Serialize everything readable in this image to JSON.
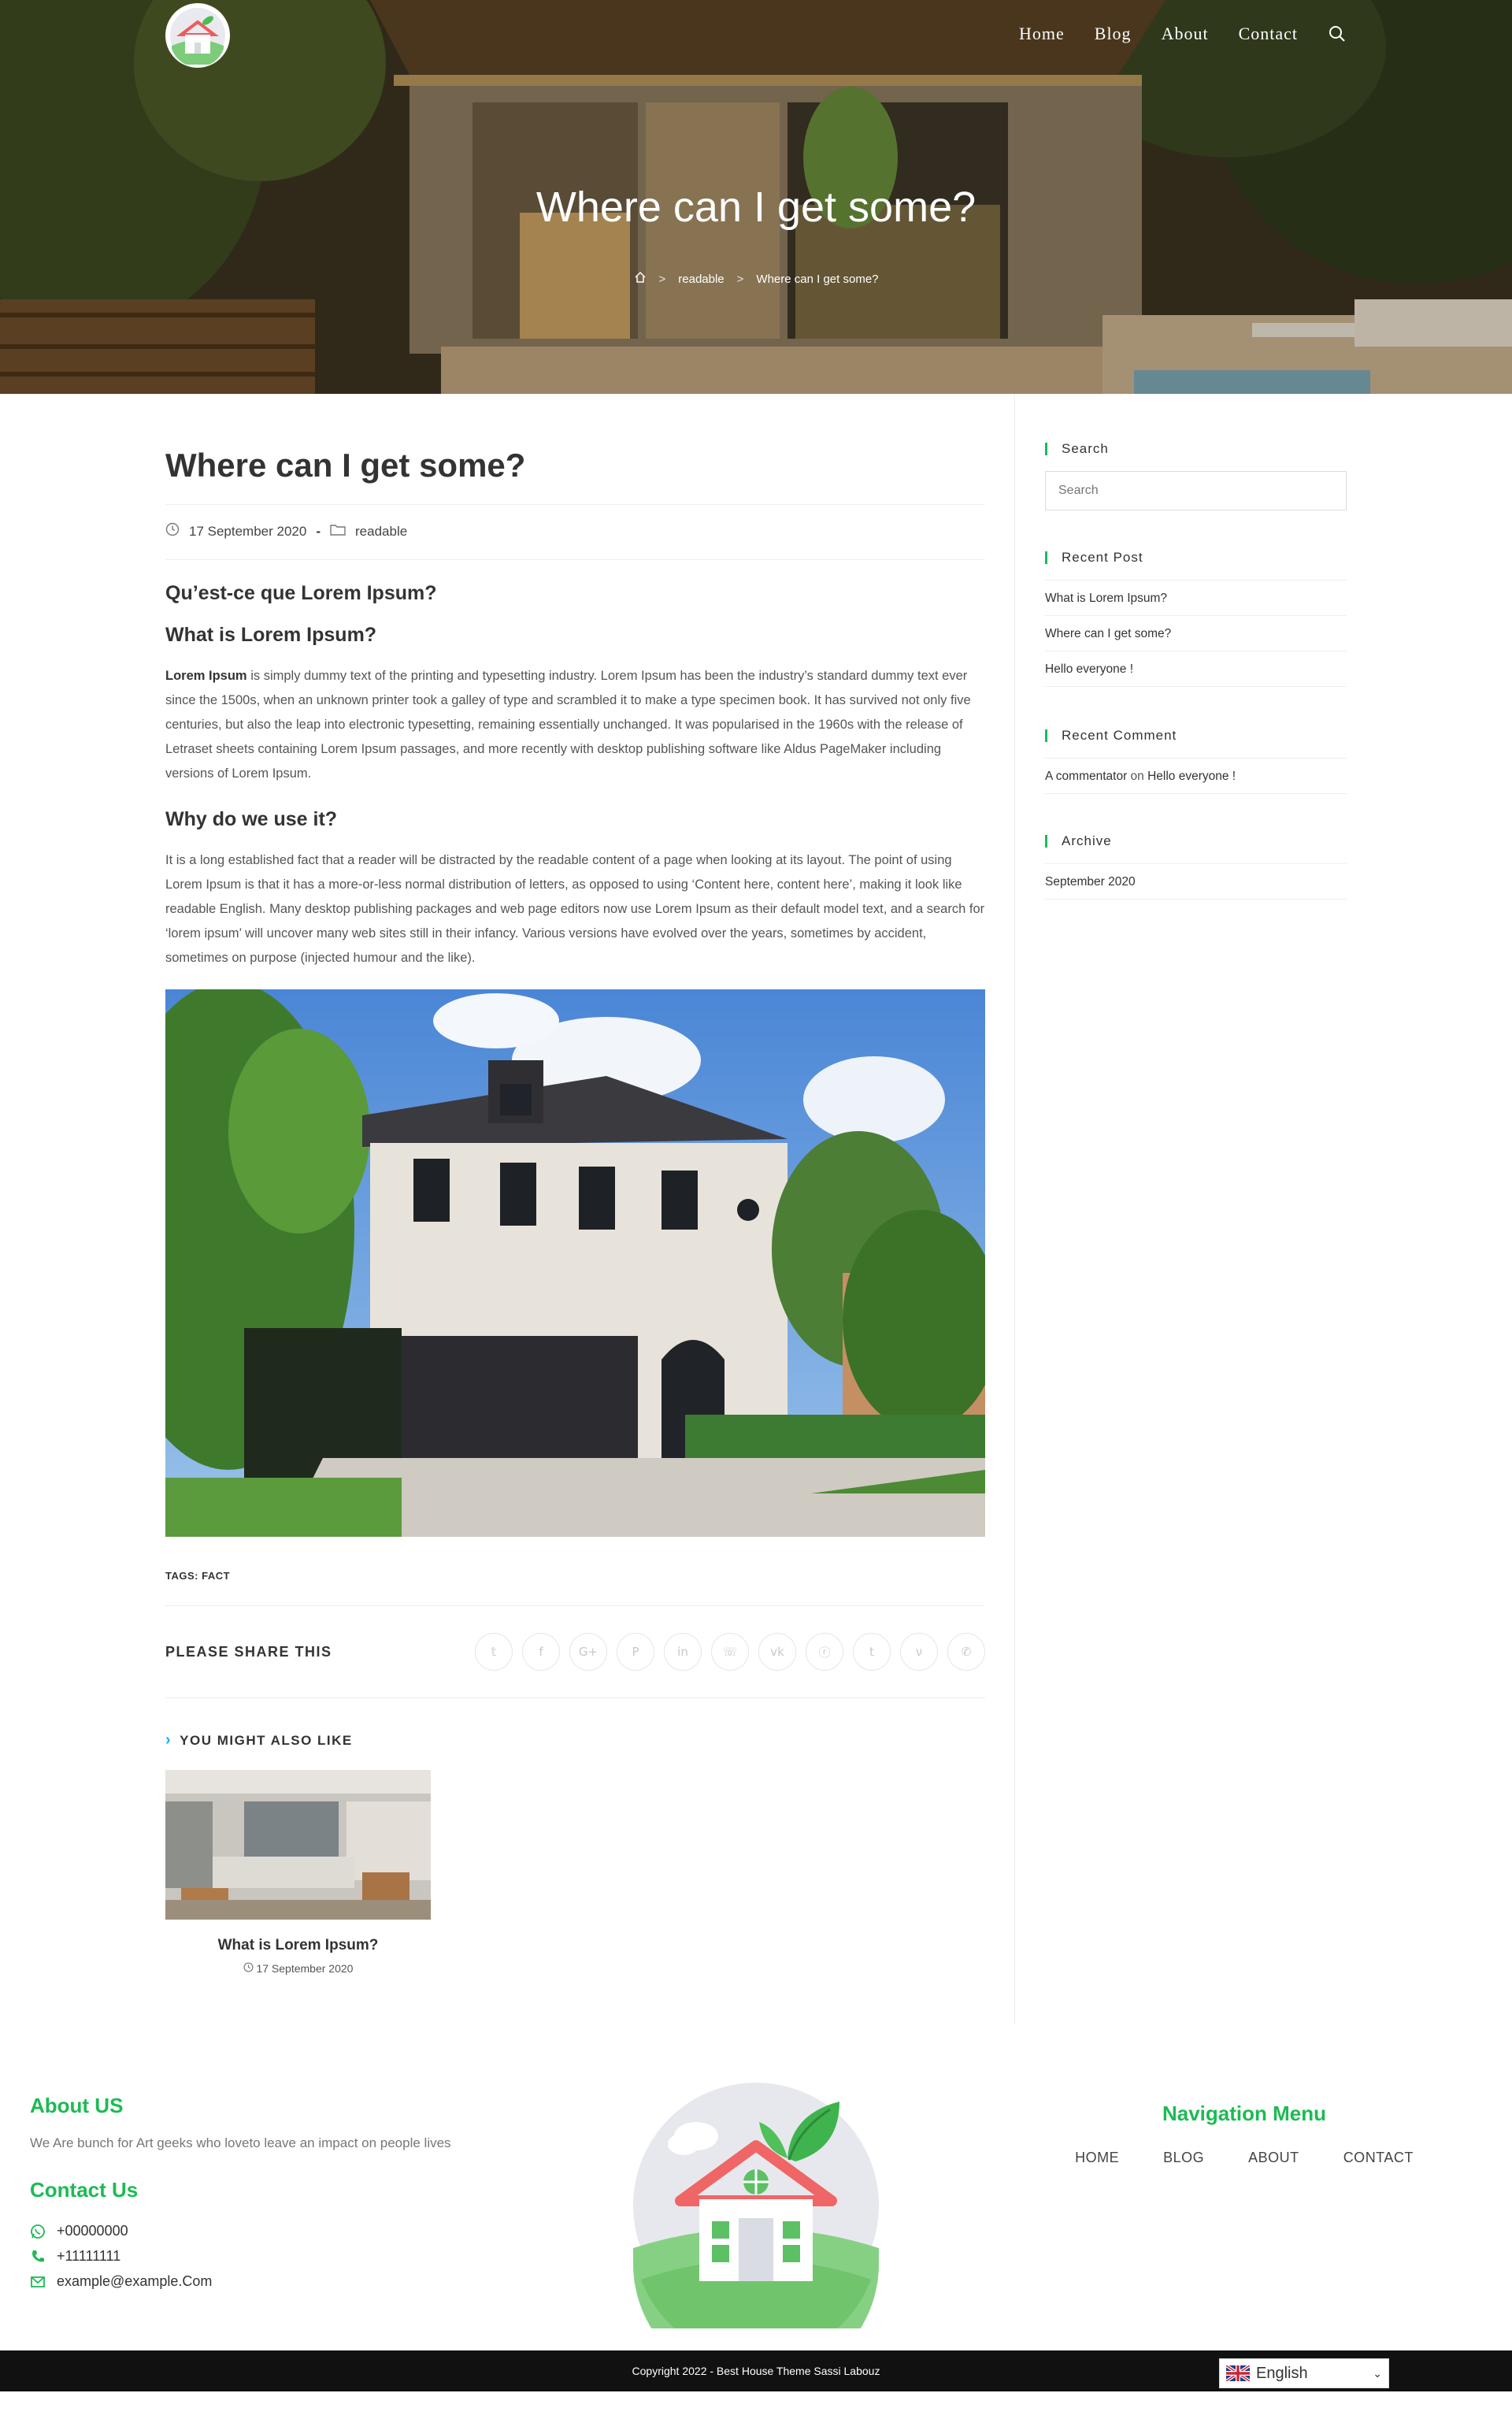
{
  "nav": {
    "items": [
      "Home",
      "Blog",
      "About",
      "Contact"
    ]
  },
  "hero": {
    "title": "Where can I get some?",
    "breadcrumb": [
      "readable",
      "Where can I get some?"
    ],
    "breadcrumb_sep": ">"
  },
  "post": {
    "title": "Where can I get some?",
    "date": "17 September 2020",
    "category": "readable",
    "h_fr": "Qu’est-ce que Lorem Ipsum?",
    "h_what": "What is Lorem Ipsum?",
    "p1_bold": "Lorem Ipsum",
    "p1_rest": " is simply dummy text of the printing and typesetting industry. Lorem Ipsum has been the industry’s standard dummy text ever since the 1500s, when an unknown printer took a galley of type and scrambled it to make a type specimen book. It has survived not only five centuries, but also the leap into electronic typesetting, remaining essentially unchanged. It was popularised in the 1960s with the release of Letraset sheets containing Lorem Ipsum passages, and more recently with desktop publishing software like Aldus PageMaker including versions of Lorem Ipsum.",
    "h_why": "Why do we use it?",
    "p2": "It is a long established fact that a reader will be distracted by the readable content of a page when looking at its layout. The point of using Lorem Ipsum is that it has a more-or-less normal distribution of letters, as opposed to using ‘Content here, content here’, making it look like readable English. Many desktop publishing packages and web page editors now use Lorem Ipsum as their default model text, and a search for ‘lorem ipsum’ will uncover many web sites still in their infancy. Various versions have evolved over the years, sometimes by accident, sometimes on purpose (injected humour and the like).",
    "tags_label": "TAGS:",
    "tags_value": "FACT"
  },
  "share": {
    "label": "PLEASE SHARE THIS",
    "icons": [
      "twitter-icon",
      "facebook-icon",
      "google-plus-icon",
      "pinterest-icon",
      "linkedin-icon",
      "viber-icon",
      "vk-icon",
      "reddit-icon",
      "tumblr-icon",
      "viadeo-icon",
      "whatsapp-icon"
    ],
    "glyphs": [
      "𝕥",
      "f",
      "G+",
      "P",
      "in",
      "☏",
      "vk",
      "ⓡ",
      "t",
      "ν",
      "✆"
    ]
  },
  "related": {
    "heading": "YOU MIGHT ALSO LIKE",
    "title": "What is Lorem Ipsum?",
    "date": "17 September 2020"
  },
  "sidebar": {
    "search_title": "Search",
    "search_placeholder": "Search",
    "recent_post_title": "Recent Post",
    "recent_posts": [
      "What is Lorem Ipsum?",
      "Where can I get some?",
      "Hello everyone !"
    ],
    "recent_comment_title": "Recent Comment",
    "comment_author": "A commentator",
    "comment_on": " on ",
    "comment_post": "Hello everyone !",
    "archive_title": "Archive",
    "archive_items": [
      "September 2020"
    ]
  },
  "footer": {
    "about_heading": "About US",
    "about_text": "We Are bunch for Art geeks who loveto leave an impact on people lives",
    "contact_heading": "Contact Us",
    "contacts": [
      "+00000000",
      "+11111111",
      "example@example.Com"
    ],
    "nav_heading": "Navigation Menu",
    "nav_items": [
      "HOME",
      "BLOG",
      "ABOUT",
      "CONTACT"
    ],
    "copyright": "Copyright 2022 - Best House Theme Sassi Labouz",
    "language": "English"
  },
  "colors": {
    "accent_green": "#1cbb54",
    "accent_blue": "#13aff0"
  }
}
